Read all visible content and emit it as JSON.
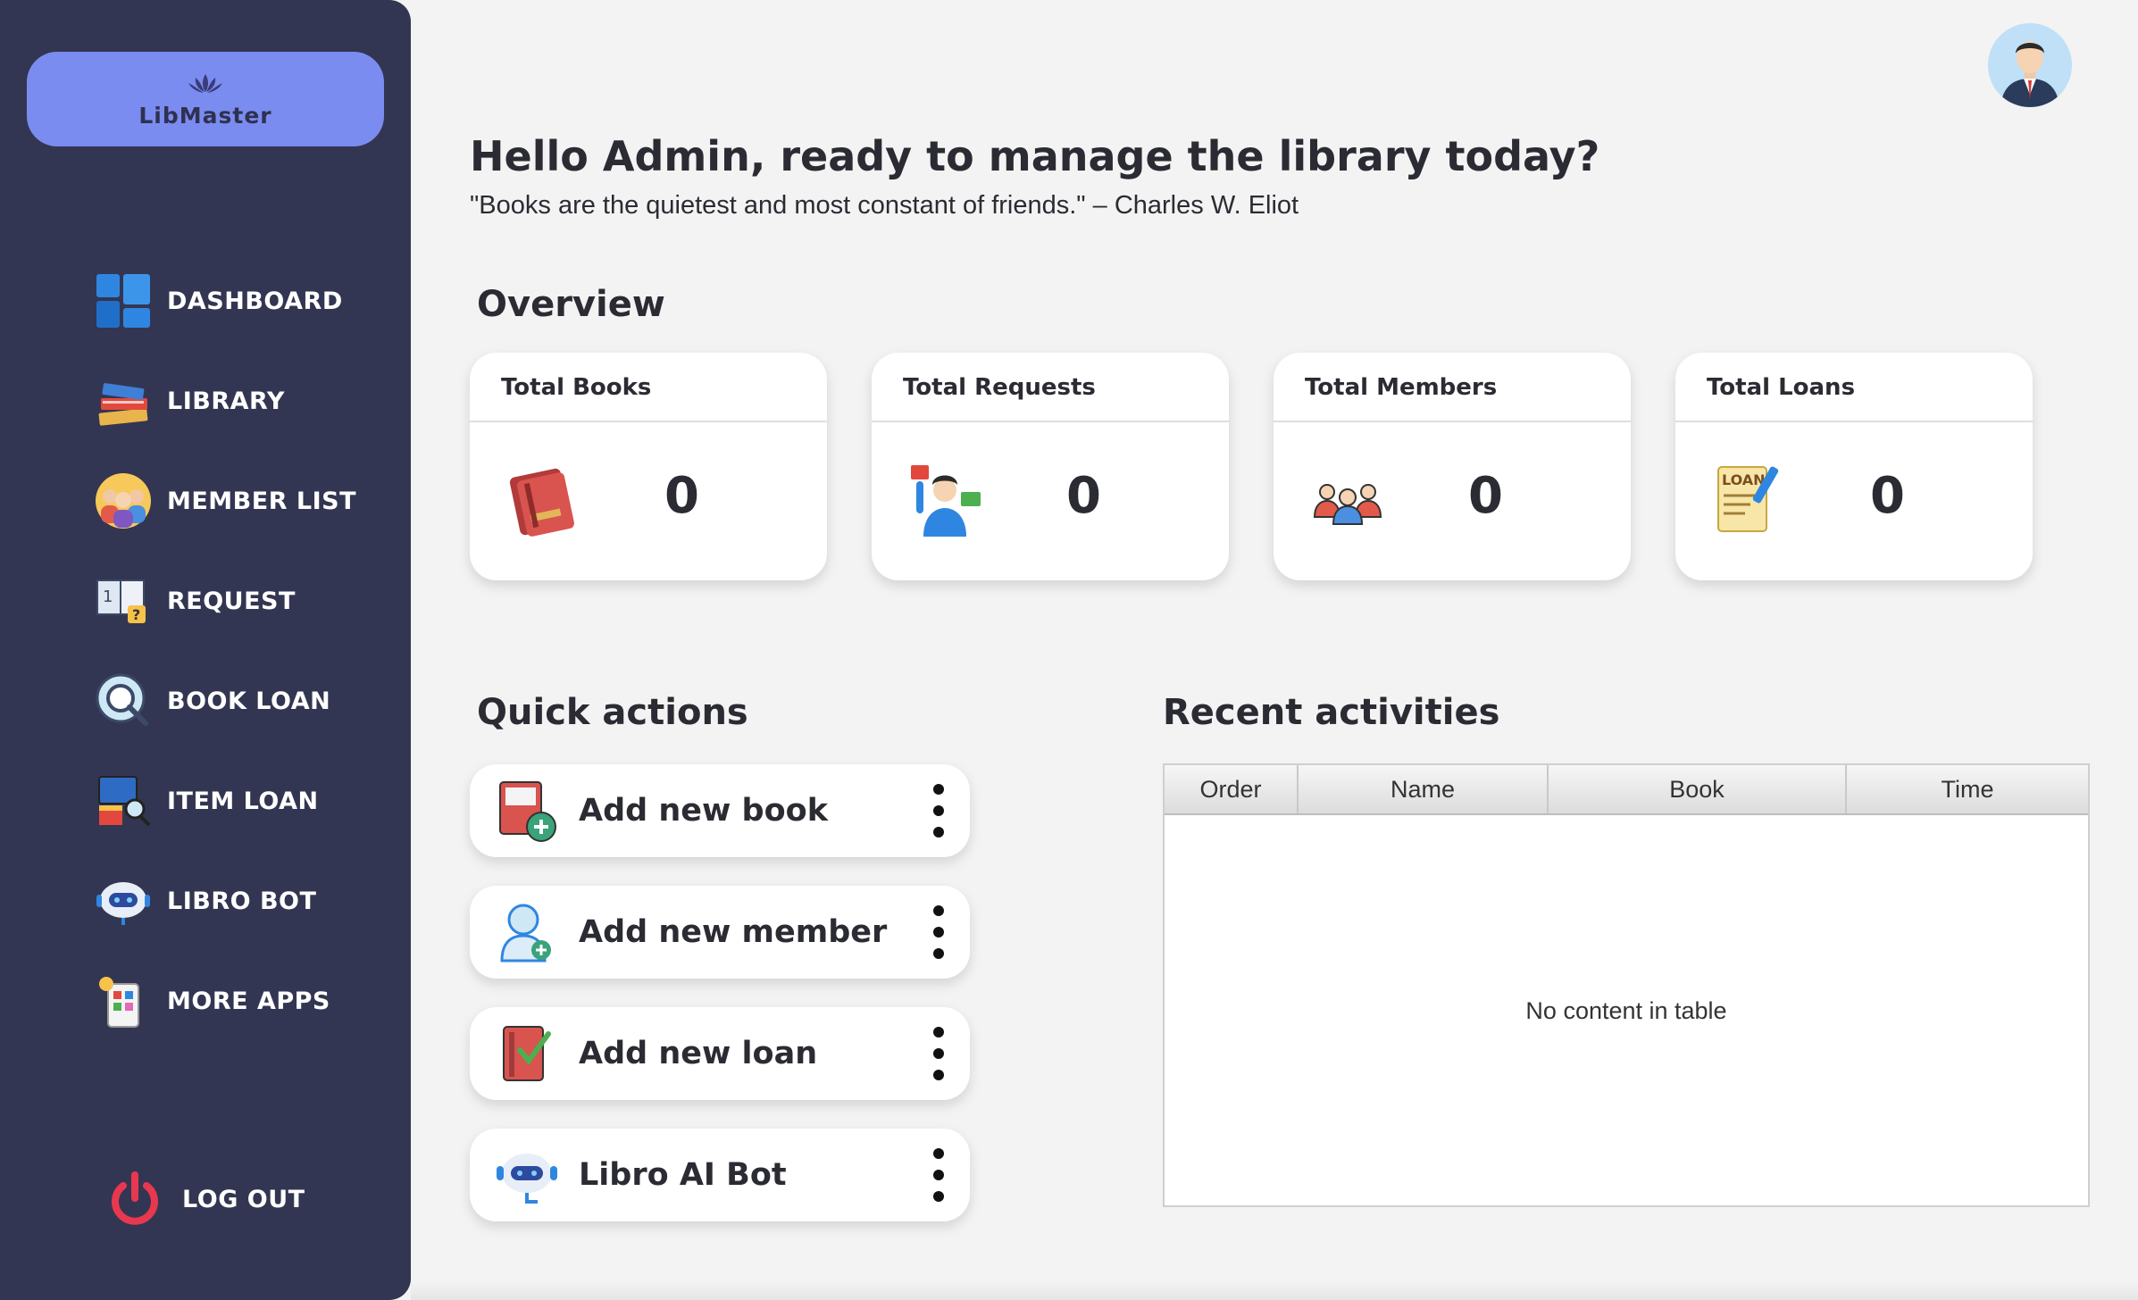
{
  "brand": {
    "name": "LibMaster",
    "logo_icon": "lotus-icon"
  },
  "sidebar": {
    "items": [
      {
        "label": "DASHBOARD",
        "icon": "dashboard-icon"
      },
      {
        "label": "LIBRARY",
        "icon": "books-stack-icon"
      },
      {
        "label": "MEMBER LIST",
        "icon": "people-icon"
      },
      {
        "label": "REQUEST",
        "icon": "request-icon"
      },
      {
        "label": "BOOK LOAN",
        "icon": "search-book-icon"
      },
      {
        "label": "ITEM LOAN",
        "icon": "item-loan-icon"
      },
      {
        "label": "LIBRO BOT",
        "icon": "robot-icon"
      },
      {
        "label": "MORE APPS",
        "icon": "apps-icon"
      }
    ],
    "logout": {
      "label": "LOG OUT",
      "icon": "power-icon"
    }
  },
  "header": {
    "greeting": "Hello Admin, ready to manage the library today?",
    "quote": "\"Books are the quietest and most constant of friends.\" – Charles W. Eliot",
    "avatar_icon": "user-avatar-icon"
  },
  "overview": {
    "title": "Overview",
    "cards": [
      {
        "title": "Total Books",
        "value": "0",
        "icon": "book-icon"
      },
      {
        "title": "Total Requests",
        "value": "0",
        "icon": "person-request-icon"
      },
      {
        "title": "Total Members",
        "value": "0",
        "icon": "members-icon"
      },
      {
        "title": "Total Loans",
        "value": "0",
        "icon": "loan-document-icon"
      }
    ]
  },
  "quick_actions": {
    "title": "Quick actions",
    "items": [
      {
        "label": "Add new book",
        "icon": "add-book-icon"
      },
      {
        "label": "Add new member",
        "icon": "add-member-icon"
      },
      {
        "label": "Add new loan",
        "icon": "add-loan-icon"
      },
      {
        "label": "Libro AI Bot",
        "icon": "robot-icon"
      }
    ]
  },
  "recent": {
    "title": "Recent activities",
    "columns": [
      "Order",
      "Name",
      "Book",
      "Time"
    ],
    "empty_text": "No content in table"
  },
  "colors": {
    "sidebar": "#333652",
    "brand": "#7b8cf0",
    "background": "#f3f3f3"
  }
}
